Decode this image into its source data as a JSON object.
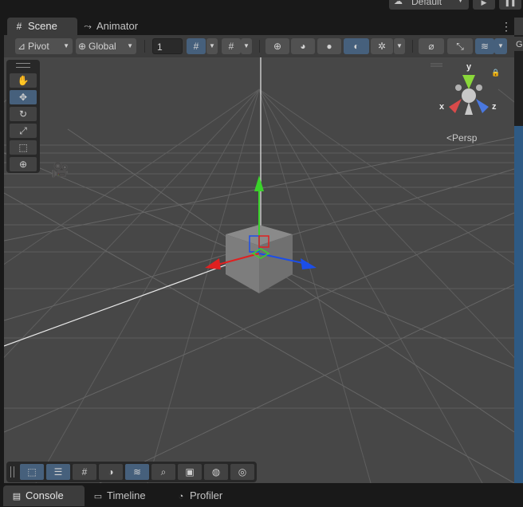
{
  "header": {
    "layout_label": "Default",
    "layout_icon": "unity-cloud-icon",
    "play_icon": "play-icon",
    "pause_icon": "pause-icon"
  },
  "tabs": [
    {
      "label": "Scene",
      "icon": "grid-icon"
    },
    {
      "label": "Animator",
      "icon": "animator-icon"
    }
  ],
  "right_panel_label": "G",
  "scene_toolbar": {
    "pivot_label": "Pivot",
    "global_label": "Global",
    "snap_value": "1"
  },
  "tools": [
    {
      "name": "hand-tool",
      "glyph": "✋"
    },
    {
      "name": "move-tool",
      "glyph": "✥"
    },
    {
      "name": "rotate-tool",
      "glyph": "↻"
    },
    {
      "name": "scale-tool",
      "glyph": "⤢"
    },
    {
      "name": "rect-tool",
      "glyph": "⬚"
    },
    {
      "name": "transform-tool",
      "glyph": "⊕"
    }
  ],
  "gizmo": {
    "x_label": "x",
    "y_label": "y",
    "z_label": "z",
    "projection_label": "Persp",
    "colors": {
      "x": "#d84a4a",
      "y": "#8ad83a",
      "z": "#4a78e0"
    }
  },
  "bottom_tools": [
    "rect-overlay-icon",
    "toolbar-settings-icon",
    "grid-toggle-icon",
    "shading-icon",
    "layers-icon",
    "search-icon",
    "camera-icon",
    "gizmos-icon",
    "navigation-icon"
  ],
  "status_tabs": [
    {
      "label": "Console",
      "icon": "console-icon"
    },
    {
      "label": "Timeline",
      "icon": "timeline-icon"
    },
    {
      "label": "Profiler",
      "icon": "profiler-icon"
    }
  ],
  "colors": {
    "accent": "#46607c",
    "viewport_bg": "#474747",
    "x_axis": "#e02020",
    "y_axis": "#3ad22a",
    "z_axis": "#1c4ee8"
  }
}
